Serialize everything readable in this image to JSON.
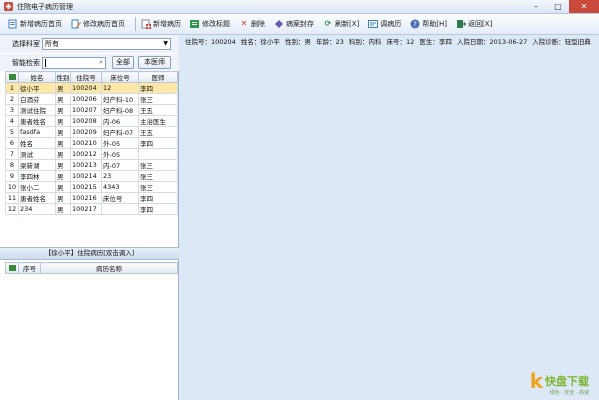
{
  "window": {
    "title": "住院电子病历管理"
  },
  "toolbar": {
    "items": [
      {
        "label": "新增病历首页",
        "icon": "new-record-icon",
        "color": "#3b7fc4"
      },
      {
        "label": "修改病历首页",
        "icon": "edit-record-icon",
        "color": "#3b7fc4"
      },
      {
        "label": "新增病历",
        "icon": "add-record-icon",
        "color": "#c94a3c"
      },
      {
        "label": "修改标题",
        "icon": "edit-title-icon",
        "color": "#2f9a4a"
      },
      {
        "label": "删除",
        "icon": "delete-icon",
        "color": "#d23a2a"
      },
      {
        "label": "病案封存",
        "icon": "archive-icon",
        "color": "#6b5bb0"
      },
      {
        "label": "刷新[X]",
        "icon": "refresh-icon",
        "color": "#2f9a4a"
      },
      {
        "label": "调病历",
        "icon": "load-record-icon",
        "color": "#3b7fc4"
      },
      {
        "label": "帮助[H]",
        "icon": "help-icon",
        "color": "#4a6fb5"
      },
      {
        "label": "返回[X]",
        "icon": "exit-icon",
        "color": "#2f7a4a"
      }
    ]
  },
  "filter": {
    "department_label": "选择科室",
    "department_value": "所有",
    "search_label": "智能检索",
    "all_button": "全部",
    "ward_button": "本医师"
  },
  "patients": {
    "columns": [
      "姓名",
      "性别",
      "住院号",
      "床位号",
      "医师"
    ],
    "rows": [
      {
        "num": "1",
        "name": "徐小平",
        "sex": "男",
        "id": "100204",
        "bed": "12",
        "doctor": "李四"
      },
      {
        "num": "2",
        "name": "白酒芬",
        "sex": "男",
        "id": "100206",
        "bed": "妇产科-10",
        "doctor": "张三"
      },
      {
        "num": "3",
        "name": "测试住院",
        "sex": "男",
        "id": "100207",
        "bed": "妇产科-08",
        "doctor": "王五"
      },
      {
        "num": "4",
        "name": "患者姓名",
        "sex": "男",
        "id": "100208",
        "bed": "内-06",
        "doctor": "主治医生"
      },
      {
        "num": "5",
        "name": "fasdfa",
        "sex": "男",
        "id": "100209",
        "bed": "妇产科-07",
        "doctor": "王五"
      },
      {
        "num": "6",
        "name": "姓名",
        "sex": "男",
        "id": "100210",
        "bed": "外-05",
        "doctor": "李四"
      },
      {
        "num": "7",
        "name": "测试",
        "sex": "男",
        "id": "100212",
        "bed": "外-05",
        "doctor": ""
      },
      {
        "num": "8",
        "name": "梁新湖",
        "sex": "男",
        "id": "100213",
        "bed": "内-07",
        "doctor": "张三"
      },
      {
        "num": "9",
        "name": "李四林",
        "sex": "男",
        "id": "100214",
        "bed": "23",
        "doctor": "张三"
      },
      {
        "num": "10",
        "name": "张小二",
        "sex": "男",
        "id": "100215",
        "bed": "4343",
        "doctor": "张三"
      },
      {
        "num": "11",
        "name": "患者姓名",
        "sex": "男",
        "id": "100216",
        "bed": "床位号",
        "doctor": "李四"
      },
      {
        "num": "12",
        "name": "234",
        "sex": "男",
        "id": "100217",
        "bed": "",
        "doctor": "李四"
      }
    ]
  },
  "history": {
    "header": "【徐小平】住院病历[双击调入]",
    "columns": [
      "序号",
      "病历名称"
    ]
  },
  "patient_info": {
    "id": "住院号：100204",
    "name": "姓名：徐小平",
    "sex": "性别：男",
    "age": "年龄：23",
    "dept": "科别：内科",
    "bed": "床号：12",
    "doctor": "医生：李四",
    "admit_date": "入院日期：2013-06-27",
    "diagnosis": "入院诊断：轻型旧典"
  },
  "watermark": {
    "mark": "k",
    "text": "快盘下载",
    "sub": "绿色 · 安全 · 高速"
  }
}
